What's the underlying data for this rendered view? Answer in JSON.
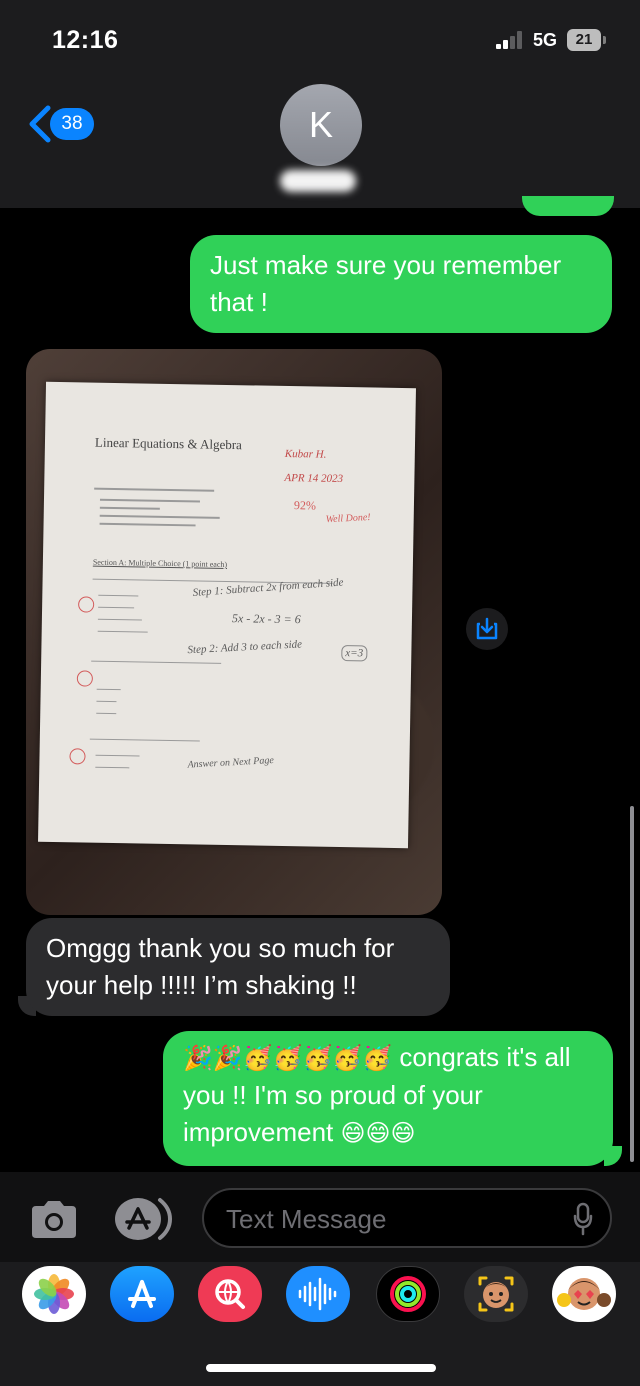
{
  "status_bar": {
    "time": "12:16",
    "network": "5G",
    "battery": "21"
  },
  "header": {
    "back_count": "38",
    "avatar_initial": "K"
  },
  "messages": [
    {
      "direction": "sent",
      "text": "Just make sure you remember that !"
    },
    {
      "direction": "received",
      "type": "photo"
    },
    {
      "direction": "received",
      "text": "Omggg thank you so much for your help !!!!! I’m shaking !!"
    },
    {
      "direction": "sent",
      "emoji_prefix": "🎉🎉🥳🥳🥳🥳🥳",
      "text": "congrats it's all you !! I'm so proud of your improvement",
      "emoji_suffix": "😄😄😄"
    }
  ],
  "photo_document": {
    "title": "Linear Equations & Algebra",
    "name_handwriting": "Kubar H.",
    "date_handwriting": "APR 14 2023",
    "score_handwriting": "92%",
    "comment_handwriting": "Well Done!",
    "section_heading": "Section A: Multiple Choice (1 point each)",
    "step1_handwriting": "Step 1: Subtract 2x from each side",
    "step2_handwriting": "Step 2: Add 3 to each side",
    "equation_handwriting": "5x - 2x - 3 = 6",
    "answer_handwriting": "x=3",
    "answer_note_handwriting": "Answer on Next Page"
  },
  "composer": {
    "placeholder": "Text Message"
  },
  "app_drawer": {
    "apps": [
      "photos-icon",
      "app-store-icon",
      "images-search-icon",
      "audio-message-icon",
      "activity-icon",
      "memoji-icon",
      "memoji-stickers-icon"
    ]
  },
  "colors": {
    "sent_bubble": "#30d158",
    "received_bubble": "#2c2c2e",
    "accent": "#0a84ff"
  }
}
